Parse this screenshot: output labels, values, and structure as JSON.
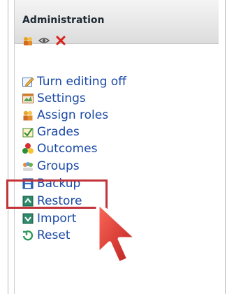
{
  "block": {
    "title": "Administration",
    "header_icons": [
      "assign-roles-icon",
      "eye-icon",
      "delete-icon"
    ]
  },
  "menu": {
    "items": [
      {
        "label": "Turn editing off",
        "icon": "edit-icon"
      },
      {
        "label": "Settings",
        "icon": "settings-icon"
      },
      {
        "label": "Assign roles",
        "icon": "assign-roles-icon"
      },
      {
        "label": "Grades",
        "icon": "grades-icon"
      },
      {
        "label": "Outcomes",
        "icon": "outcomes-icon"
      },
      {
        "label": "Groups",
        "icon": "groups-icon",
        "highlighted": true
      },
      {
        "label": "Backup",
        "icon": "backup-icon"
      },
      {
        "label": "Restore",
        "icon": "restore-icon"
      },
      {
        "label": "Import",
        "icon": "import-icon"
      },
      {
        "label": "Reset",
        "icon": "reset-icon"
      }
    ]
  },
  "colors": {
    "link": "#1a49a6",
    "highlight": "#c0343a",
    "cursor": "#c62828"
  }
}
